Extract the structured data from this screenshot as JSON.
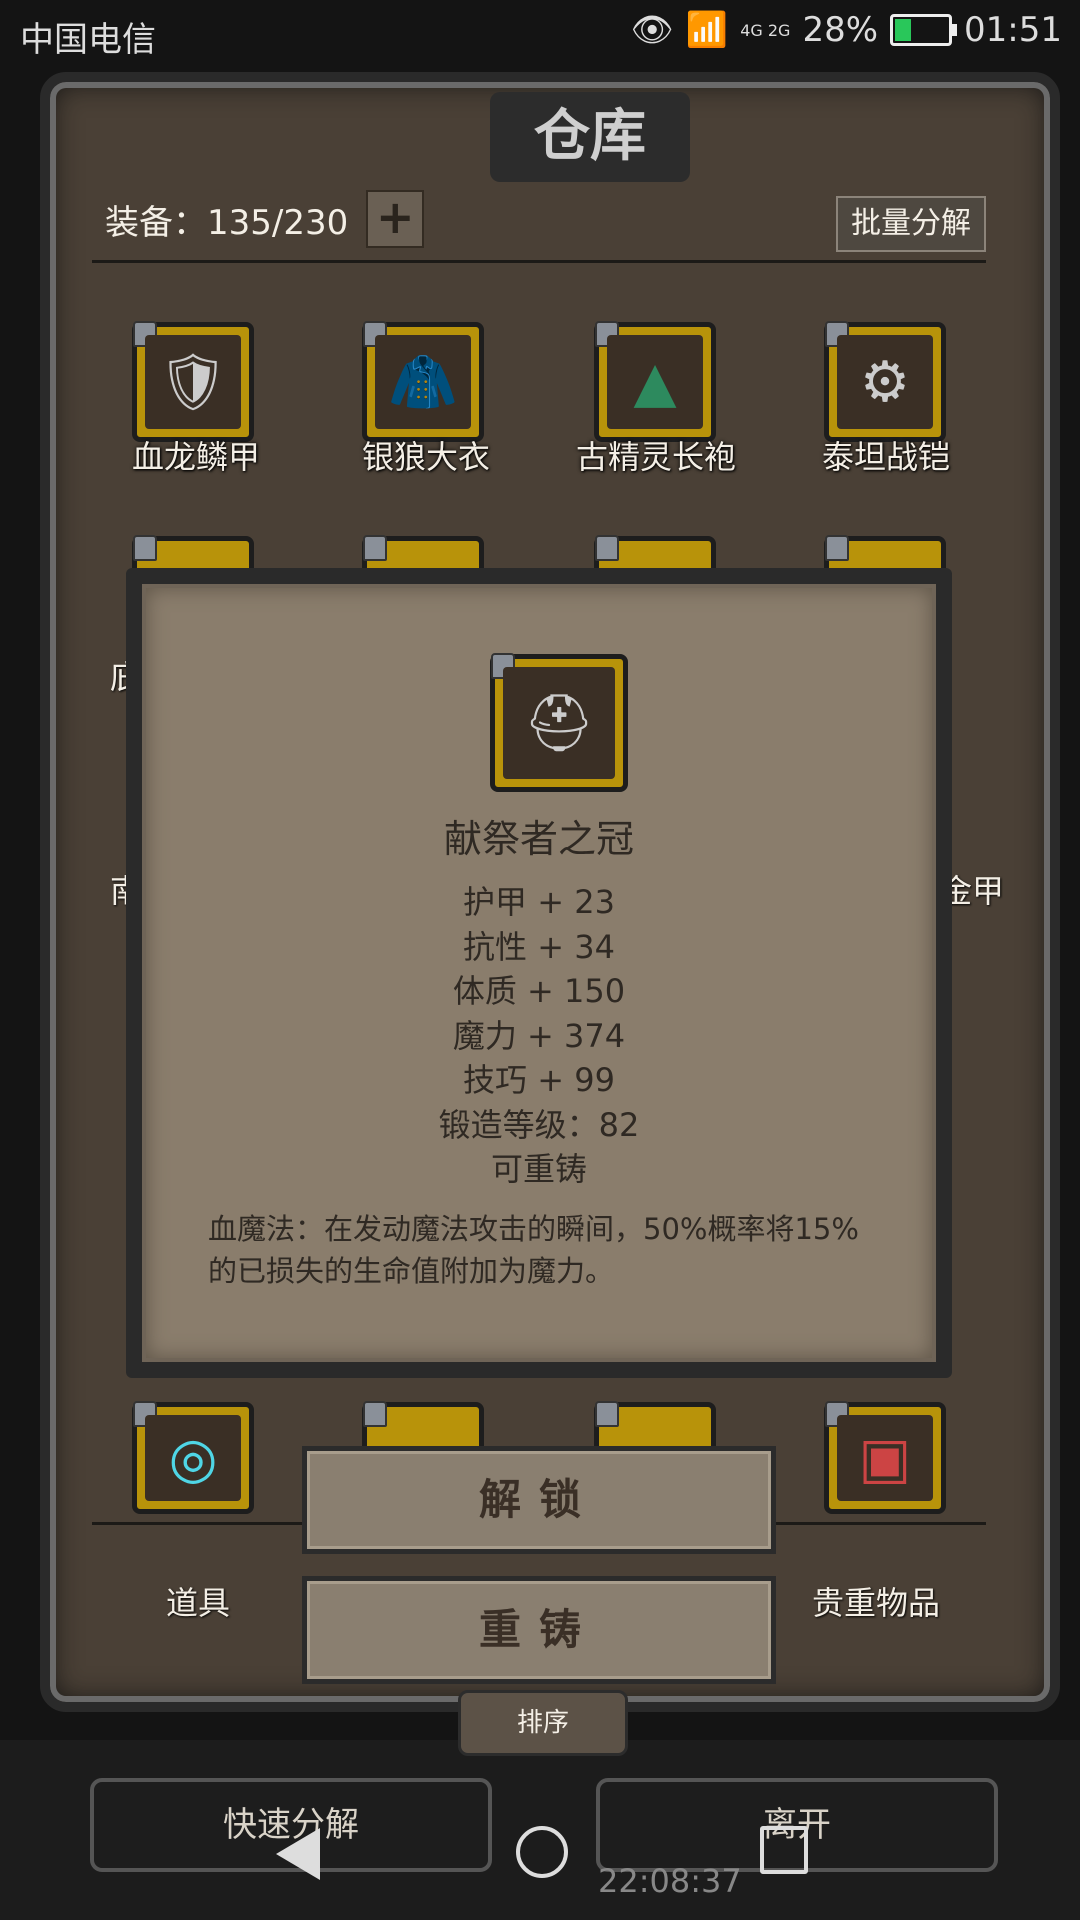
{
  "status_bar": {
    "carrier": "中国电信",
    "network": "4G 2G",
    "battery": "28%",
    "time": "01:51"
  },
  "window": {
    "title": "仓库",
    "capacity_label": "装备：135/230",
    "add_button": "+",
    "batch_decompose": "批量分解"
  },
  "items_row1": [
    {
      "name": "血龙鳞甲",
      "icon": "armor-icon"
    },
    {
      "name": "银狼大衣",
      "icon": "coat-icon"
    },
    {
      "name": "古精灵长袍",
      "icon": "robe-icon"
    },
    {
      "name": "泰坦战铠",
      "icon": "shoulder-armor-icon"
    }
  ],
  "edge_labels": {
    "row2_left": "庇",
    "row3_left": "南",
    "row3_right": "金甲"
  },
  "detail": {
    "name": "献祭者之冠",
    "icon": "helmet-icon",
    "stats": [
      "护甲 + 23",
      "抗性 + 34",
      "体质 + 150",
      "魔力 + 374",
      "技巧 + 99",
      "锻造等级：82",
      "可重铸"
    ],
    "description": "血魔法：在发动魔法攻击的瞬间，50%概率将15%的已损失的生命值附加为魔力。"
  },
  "actions": {
    "unlock": "解锁",
    "reforge": "重铸"
  },
  "tabs": {
    "items": "道具",
    "valuables": "贵重物品"
  },
  "sort_button": "排序",
  "bottom_buttons": {
    "quick_decompose": "快速分解",
    "leave": "离开"
  },
  "background_clock": "22:08:37"
}
